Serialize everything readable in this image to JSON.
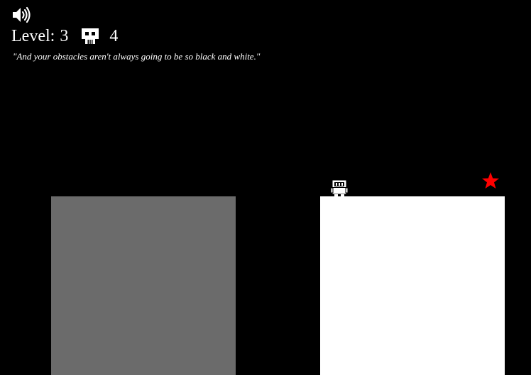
{
  "hud": {
    "level_label": "Level:",
    "level_value": "3",
    "deaths_value": "4"
  },
  "quote": "\"And your obstacles aren't always going to be so black and white.\"",
  "icons": {
    "sound": "speaker-icon",
    "deaths": "skull-icon",
    "goal": "star-icon"
  },
  "colors": {
    "background": "#000000",
    "gray_block": "#6b6b6b",
    "white_block": "#ffffff",
    "goal_star": "#ff0000"
  }
}
